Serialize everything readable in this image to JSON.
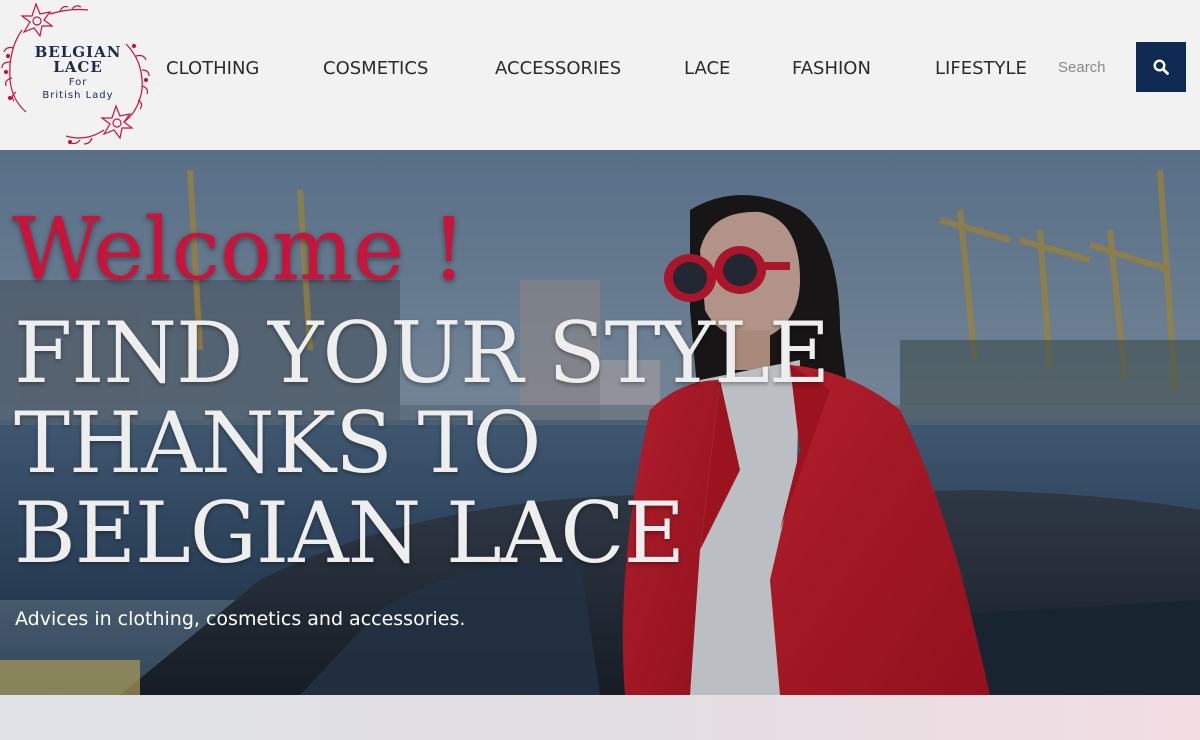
{
  "logo": {
    "title_line1": "BELGIAN",
    "title_line2": "LACE",
    "sub_line1": "For",
    "sub_line2": "British Lady"
  },
  "nav": {
    "items": [
      "CLOTHING",
      "COSMETICS",
      "ACCESSORIES",
      "LACE",
      "FASHION",
      "LIFESTYLE"
    ]
  },
  "search": {
    "placeholder": "Search",
    "icon": "search-icon"
  },
  "hero": {
    "welcome": "Welcome !",
    "headline_line1": "FIND YOUR STYLE",
    "headline_line2": "THANKS TO",
    "headline_line3": "BELGIAN LACE",
    "tagline": "Advices in clothing, cosmetics and accessories.",
    "image": "woman-in-red-suit-photo"
  },
  "colors": {
    "accent": "#c8143a",
    "navy": "#0f2a52",
    "header_bg": "#f2f2f2"
  }
}
